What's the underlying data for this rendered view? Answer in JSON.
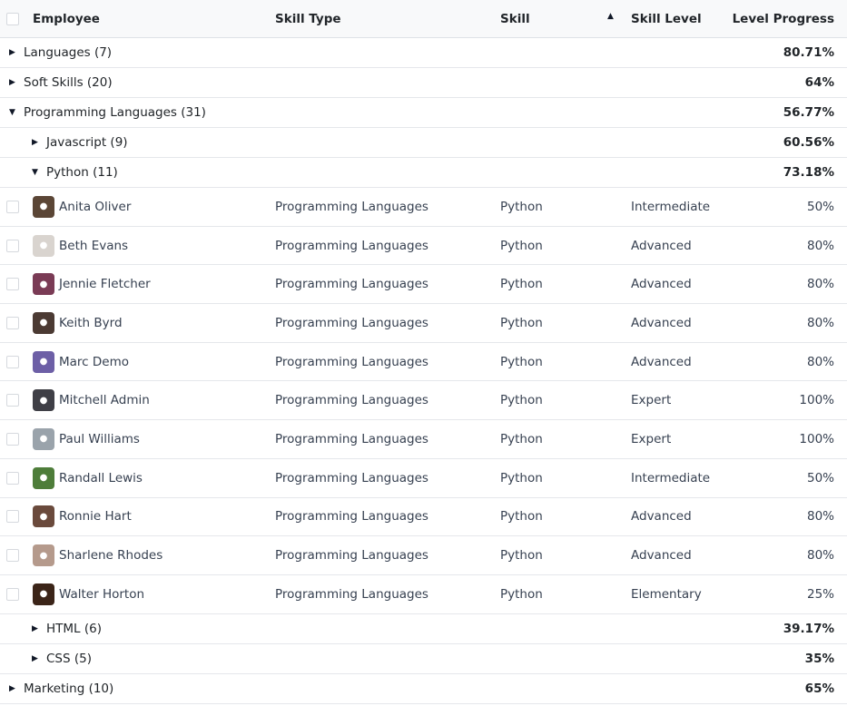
{
  "header": {
    "employee": "Employee",
    "skill_type": "Skill Type",
    "skill": "Skill",
    "skill_level": "Skill Level",
    "level_progress": "Level Progress"
  },
  "groups_top": [
    {
      "label": "Languages (7)",
      "progress": "80.71%"
    },
    {
      "label": "Soft Skills (20)",
      "progress": "64%"
    },
    {
      "label": "Programming Languages (31)",
      "progress": "56.77%"
    }
  ],
  "sub_groups_before": [
    {
      "label": "Javascript (9)",
      "progress": "60.56%"
    },
    {
      "label": "Python (11)",
      "progress": "73.18%"
    }
  ],
  "records": [
    {
      "name": "Anita Oliver",
      "type": "Programming Languages",
      "skill": "Python",
      "level": "Intermediate",
      "progress": "50%",
      "avatar_color": "#5b4636"
    },
    {
      "name": "Beth Evans",
      "type": "Programming Languages",
      "skill": "Python",
      "level": "Advanced",
      "progress": "80%",
      "avatar_color": "#d9d4cf"
    },
    {
      "name": "Jennie Fletcher",
      "type": "Programming Languages",
      "skill": "Python",
      "level": "Advanced",
      "progress": "80%",
      "avatar_color": "#7a3b55"
    },
    {
      "name": "Keith Byrd",
      "type": "Programming Languages",
      "skill": "Python",
      "level": "Advanced",
      "progress": "80%",
      "avatar_color": "#4b3a33"
    },
    {
      "name": "Marc Demo",
      "type": "Programming Languages",
      "skill": "Python",
      "level": "Advanced",
      "progress": "80%",
      "avatar_color": "#6d5fa6"
    },
    {
      "name": "Mitchell Admin",
      "type": "Programming Languages",
      "skill": "Python",
      "level": "Expert",
      "progress": "100%",
      "avatar_color": "#3f3f46"
    },
    {
      "name": "Paul Williams",
      "type": "Programming Languages",
      "skill": "Python",
      "level": "Expert",
      "progress": "100%",
      "avatar_color": "#9aa3ab"
    },
    {
      "name": "Randall Lewis",
      "type": "Programming Languages",
      "skill": "Python",
      "level": "Intermediate",
      "progress": "50%",
      "avatar_color": "#4e7d3a"
    },
    {
      "name": "Ronnie Hart",
      "type": "Programming Languages",
      "skill": "Python",
      "level": "Advanced",
      "progress": "80%",
      "avatar_color": "#6a4a3c"
    },
    {
      "name": "Sharlene Rhodes",
      "type": "Programming Languages",
      "skill": "Python",
      "level": "Advanced",
      "progress": "80%",
      "avatar_color": "#b59a8c"
    },
    {
      "name": "Walter Horton",
      "type": "Programming Languages",
      "skill": "Python",
      "level": "Elementary",
      "progress": "25%",
      "avatar_color": "#3b2418"
    }
  ],
  "sub_groups_after": [
    {
      "label": "HTML (6)",
      "progress": "39.17%"
    },
    {
      "label": "CSS (5)",
      "progress": "35%"
    }
  ],
  "groups_bottom": [
    {
      "label": "Marketing (10)",
      "progress": "65%"
    }
  ]
}
